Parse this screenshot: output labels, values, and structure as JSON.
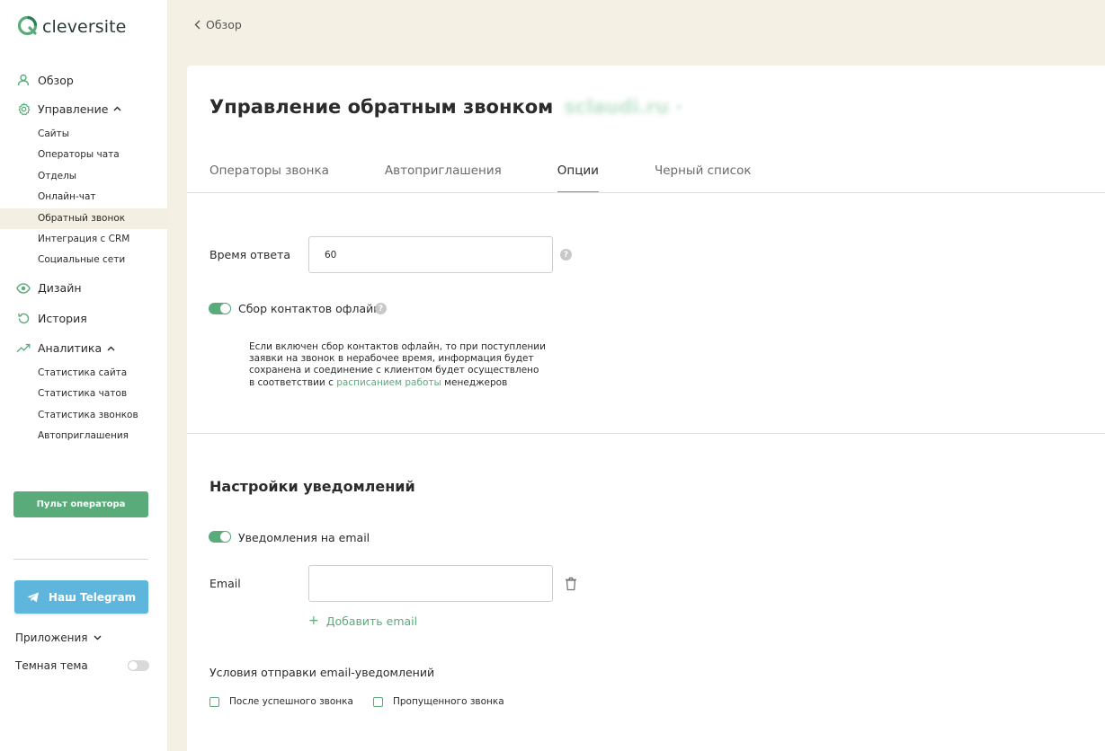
{
  "brand": {
    "name": "cleversite",
    "accent": "#5aab7a",
    "telegram_color": "#5fb6dc"
  },
  "sidebar": {
    "overview": "Обзор",
    "management": "Управление",
    "management_items": [
      "Сайты",
      "Операторы чата",
      "Отделы",
      "Онлайн-чат",
      "Обратный звонок",
      "Интеграция с CRM",
      "Социальные сети"
    ],
    "active_item": "Обратный звонок",
    "design": "Дизайн",
    "history": "История",
    "analytics": "Аналитика",
    "analytics_items": [
      "Статистика сайта",
      "Статистика чатов",
      "Статистика звонков",
      "Автоприглашения"
    ],
    "operator_button": "Пульт оператора",
    "telegram_button": "Наш Telegram",
    "apps": "Приложения",
    "dark_theme": "Темная тема"
  },
  "topbar": {
    "back_label": "Обзор"
  },
  "page": {
    "title": "Управление обратным звонком",
    "site_name_blurred": "sclaudi.ru",
    "tabs": [
      "Операторы звонка",
      "Автоприглашения",
      "Опции",
      "Черный список"
    ],
    "active_tab": "Опции"
  },
  "options": {
    "response_time_label": "Время ответа",
    "response_time_value": "60",
    "offline_toggle_label": "Сбор контактов офлайн",
    "offline_toggle_on": true,
    "offline_desc_before": "Если включен сбор контактов офлайн, то при поступлении заявки на звонок в нерабочее время, информация будет сохранена и соединение с клиентом будет осуществлено в соответствии с ",
    "offline_desc_link": "расписанием работы",
    "offline_desc_after": " менеджеров"
  },
  "notifications": {
    "section_title": "Настройки уведомлений",
    "email_toggle_label": "Уведомления на email",
    "email_toggle_on": true,
    "email_label": "Email",
    "email_value": "",
    "add_email": "Добавить email",
    "conditions_title": "Условия отправки email-уведомлений",
    "conditions": [
      "После успешного звонка",
      "Пропущенного звонка"
    ]
  }
}
